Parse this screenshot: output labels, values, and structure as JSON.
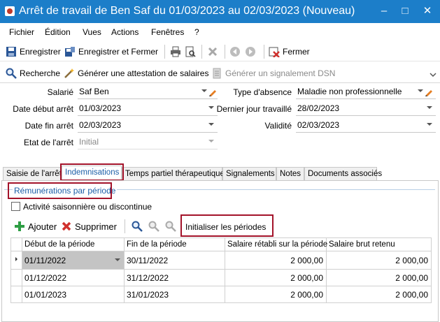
{
  "window": {
    "title": "Arrêt de travail de Ben Saf du 01/03/2023 au 02/03/2023 (Nouveau)",
    "minimize": "–",
    "maximize": "□",
    "close": "✕",
    "titlebar_color": "#1c7ec9"
  },
  "menu": [
    "Fichier",
    "Édition",
    "Vues",
    "Actions",
    "Fenêtres",
    "?"
  ],
  "toolbar": {
    "save": "Enregistrer",
    "save_close": "Enregistrer et Fermer",
    "close": "Fermer"
  },
  "actions": {
    "search": "Recherche",
    "generate_certificate": "Générer une attestation de salaires",
    "generate_dsn": "Générer un signalement DSN"
  },
  "form": {
    "employee_label": "Salarié",
    "employee_value": "Saf Ben",
    "start_label": "Date début arrêt",
    "start_value": "01/03/2023",
    "end_label": "Date fin arrêt",
    "end_value": "02/03/2023",
    "state_label": "Etat de l'arrêt",
    "state_value": "Initial",
    "absence_type_label": "Type d'absence",
    "absence_type_value": "Maladie non professionnelle",
    "last_day_label": "Dernier jour travaillé",
    "last_day_value": "28/02/2023",
    "validity_label": "Validité",
    "validity_value": "02/03/2023"
  },
  "tabs": [
    "Saisie de l'arrêt",
    "Indemnisations",
    "Temps partiel thérapeutique",
    "Signalements",
    "Notes",
    "Documents associés"
  ],
  "active_tab": "Indemnisations",
  "subtab": "Rémunérations par période",
  "seasonal_checkbox": "Activité saisonnière ou discontinue",
  "grid_toolbar": {
    "add": "Ajouter",
    "delete": "Supprimer",
    "init_periods": "Initialiser les périodes"
  },
  "grid": {
    "columns": [
      "Début de la période",
      "Fin de la période",
      "Salaire rétabli sur la période",
      "Salaire brut retenu"
    ],
    "rows": [
      [
        "01/11/2022",
        "30/11/2022",
        "2 000,00",
        "2 000,00"
      ],
      [
        "01/12/2022",
        "31/12/2022",
        "2 000,00",
        "2 000,00"
      ],
      [
        "01/01/2023",
        "31/01/2023",
        "2 000,00",
        "2 000,00"
      ]
    ]
  },
  "highlight_color": "#a3132a"
}
